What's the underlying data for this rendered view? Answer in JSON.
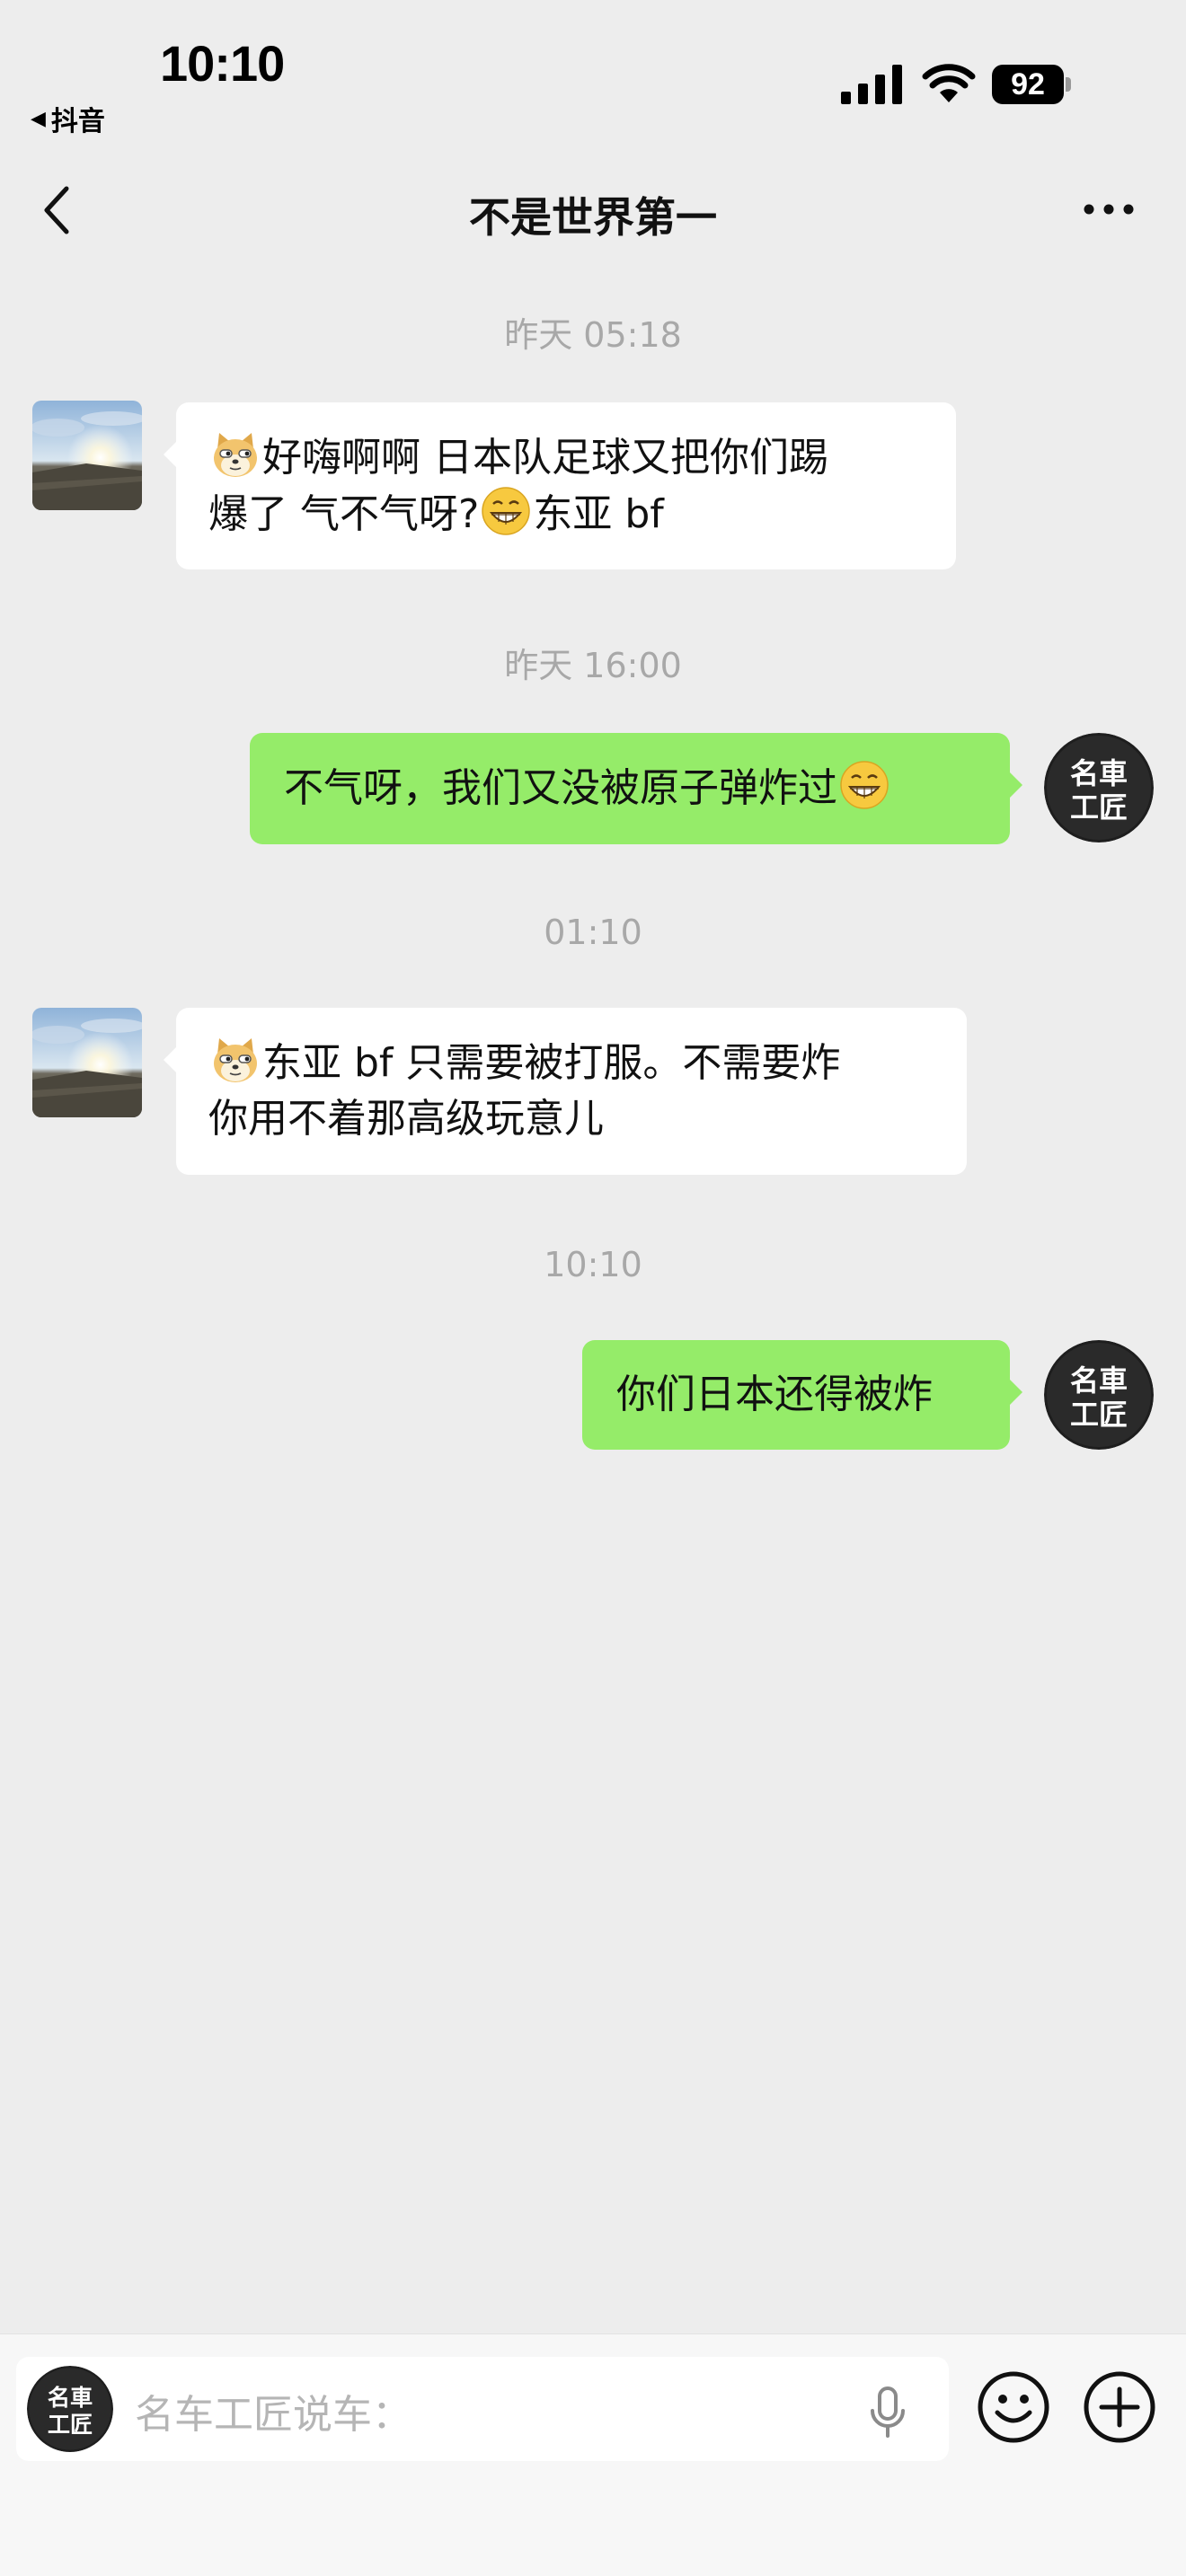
{
  "status_bar": {
    "time": "10:10",
    "back_app": "抖音",
    "battery": "92"
  },
  "nav": {
    "title": "不是世界第一"
  },
  "messages": [
    {
      "timestamp": "昨天 05:18",
      "side": "left",
      "lines": [
        "好嗨啊啊  日本队足球又把你们踢",
        "爆了  气不气呀?",
        "东亚 bf"
      ]
    },
    {
      "timestamp": "昨天 16:00",
      "side": "right",
      "lines": [
        "不气呀，我们又没被原子弹炸过"
      ]
    },
    {
      "timestamp": "01:10",
      "side": "left",
      "lines": [
        "东亚 bf 只需要被打服。不需要炸",
        "你用不着那高级玩意儿"
      ]
    },
    {
      "timestamp": "10:10",
      "side": "right",
      "lines": [
        "你们日本还得被炸"
      ]
    }
  ],
  "avatar_logo_text": [
    "名車",
    "工匠"
  ],
  "input": {
    "placeholder": "名车工匠说车："
  },
  "icons": {
    "nav_back": "chevron-left-icon",
    "nav_more": "more-horizontal-icon",
    "mic": "microphone-icon",
    "emoji": "emoji-icon",
    "plus": "plus-icon",
    "doge_emoji": "doge-emoji",
    "grin_emoji": "grinning-emoji"
  },
  "colors": {
    "background": "#ededed",
    "bubble_self": "#95ec69",
    "bubble_other": "#ffffff",
    "timestamp": "#a8a8a8"
  }
}
